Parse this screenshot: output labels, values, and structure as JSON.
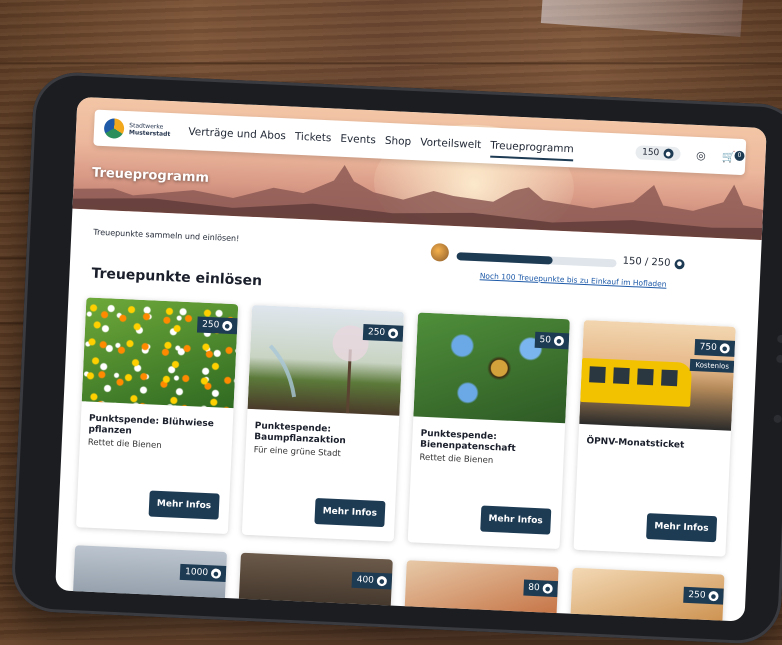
{
  "nav": {
    "logo_line1": "Stadtwerke",
    "logo_line2": "Musterstadt",
    "items": [
      "Verträge und Abos",
      "Tickets",
      "Events",
      "Shop",
      "Vorteilswelt",
      "Treueprogramm"
    ],
    "active_item": "Treueprogramm",
    "points": "150",
    "cart_count": "0",
    "icons": [
      "user-icon",
      "cart-icon",
      "coin-icon"
    ]
  },
  "hero": {
    "title": "Treueprogramm"
  },
  "intro": {
    "text": "Treuepunkte sammeln und einlösen!"
  },
  "progress": {
    "current": 150,
    "target": 250,
    "fraction": 0.6,
    "label": "150 / 250",
    "link": "Noch 100 Treuepunkte bis zu Einkauf im Hofladen"
  },
  "section": {
    "title": "Treuepunkte einlösen"
  },
  "cards": [
    {
      "points": "250",
      "title": "Punktspende: Blühwiese pflanzen",
      "subtitle": "Rettet die Bienen",
      "button": "Mehr Infos"
    },
    {
      "points": "250",
      "title": "Punktespende: Baumpflanzaktion",
      "subtitle": "Für eine grüne Stadt",
      "button": "Mehr Infos"
    },
    {
      "points": "50",
      "title": "Punktespende: Bienenpatenschaft",
      "subtitle": "Rettet die Bienen",
      "button": "Mehr Infos"
    },
    {
      "points": "750",
      "free": "Kostenlos",
      "title": "ÖPNV-Monatsticket",
      "subtitle": "",
      "button": "Mehr Infos"
    }
  ],
  "row2": [
    {
      "points": "1000"
    },
    {
      "points": "400"
    },
    {
      "points": "80"
    },
    {
      "points": "250"
    }
  ]
}
